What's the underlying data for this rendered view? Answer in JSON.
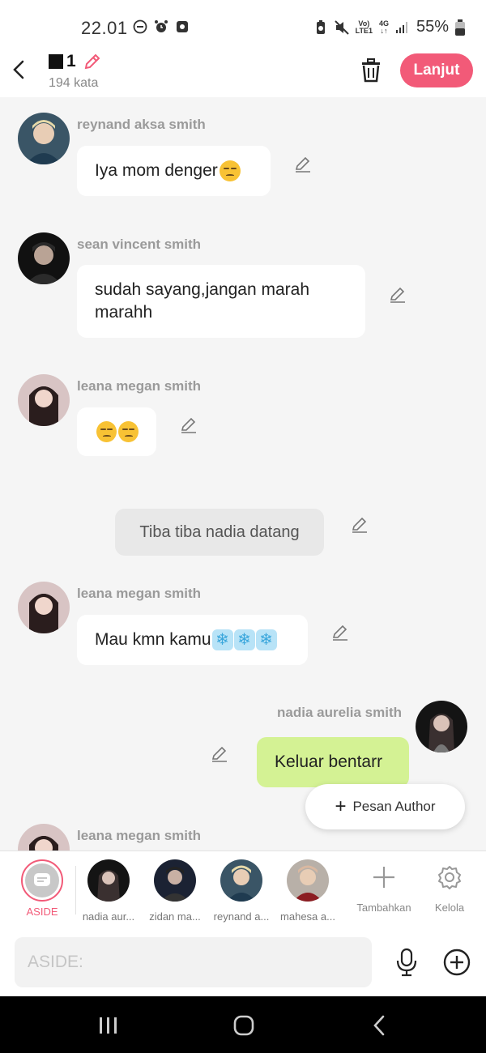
{
  "status_bar": {
    "time": "22.01",
    "carrier_top": "Vo)",
    "carrier_bottom": "LTE1",
    "network_top": "4G",
    "network_bottom": "↓↑",
    "battery": "55%"
  },
  "header": {
    "chapter_number": "1",
    "word_count": "194 kata",
    "next_label": "Lanjut"
  },
  "messages": [
    {
      "sender": "reynand aksa smith",
      "text": "Iya mom denger"
    },
    {
      "sender": "sean vincent smith",
      "text_line1": "sudah sayang,jangan marah",
      "text_line2": "marahh"
    },
    {
      "sender": "leana megan smith"
    },
    {
      "narration": "Tiba tiba nadia datang"
    },
    {
      "sender": "leana megan smith",
      "text": "Mau kmn kamu",
      "snowflake": "❄"
    },
    {
      "sender": "nadia aurelia smith",
      "text": "Keluar bentarr"
    },
    {
      "sender": "leana megan smith"
    }
  ],
  "author_button": {
    "label": "Pesan Author"
  },
  "characters": {
    "aside_label": "ASIDE",
    "items": [
      {
        "label": "nadia aur..."
      },
      {
        "label": "zidan ma..."
      },
      {
        "label": "reynand a..."
      },
      {
        "label": "mahesa a..."
      }
    ],
    "add_label": "Tambahkan",
    "manage_label": "Kelola"
  },
  "input": {
    "placeholder": "ASIDE:"
  },
  "colors": {
    "accent": "#f25a78",
    "green_bubble": "#d4f294",
    "background": "#f5f5f5"
  },
  "icons": [
    "dnd-icon",
    "alarm-icon",
    "notification-icon",
    "battery-saver-icon",
    "mute-icon",
    "signal-icon",
    "battery-icon",
    "back-arrow-icon",
    "pencil-icon",
    "trash-icon",
    "plus-icon",
    "gear-icon",
    "mic-icon",
    "add-circle-icon",
    "recents-icon",
    "home-icon",
    "nav-back-icon"
  ]
}
